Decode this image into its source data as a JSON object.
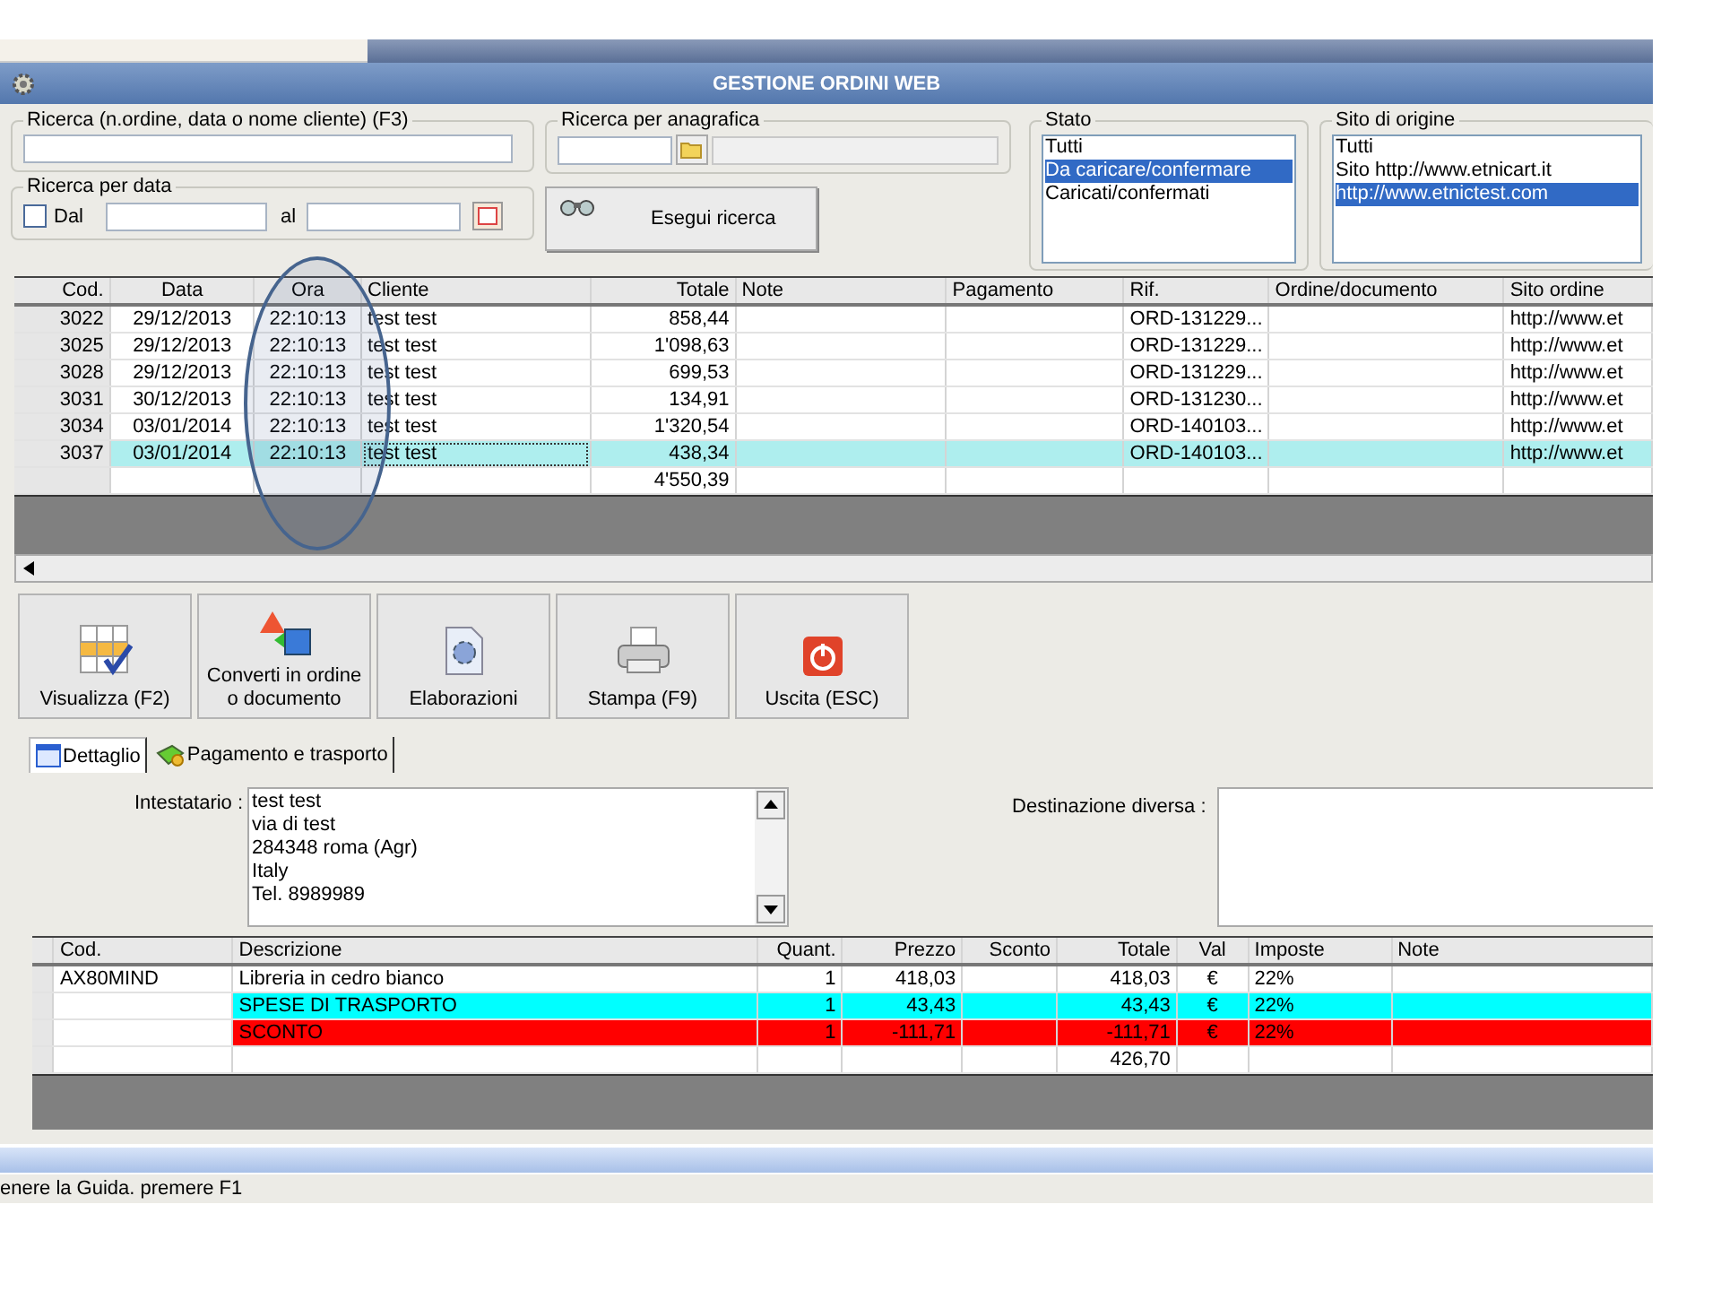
{
  "window": {
    "title": "GESTIONE ORDINI WEB"
  },
  "search": {
    "label": "Ricerca (n.ordine, data o nome cliente) (F3)"
  },
  "anagrafica": {
    "label": "Ricerca per anagrafica"
  },
  "date_search": {
    "label": "Ricerca per data",
    "from_label": "Dal",
    "checked": false,
    "to_label": "al"
  },
  "search_button": "Esegui ricerca",
  "stato": {
    "label": "Stato",
    "options": [
      {
        "label": "Tutti",
        "selected": false
      },
      {
        "label": "Da caricare/confermare",
        "selected": true
      },
      {
        "label": "Caricati/confermati",
        "selected": false
      }
    ]
  },
  "sito": {
    "label": "Sito di origine",
    "options": [
      {
        "label": "Tutti",
        "selected": false
      },
      {
        "label": "Sito http://www.etnicart.it",
        "selected": false
      },
      {
        "label": "http://www.etnictest.com",
        "selected": true
      }
    ]
  },
  "orders": {
    "columns": [
      "Cod.",
      "Data",
      "Ora",
      "Cliente",
      "Totale",
      "Note",
      "Pagamento",
      "Rif.",
      "Ordine/documento",
      "Sito ordine"
    ],
    "rows": [
      {
        "cells": [
          "3022",
          "29/12/2013",
          "22:10:13",
          "test test",
          "858,44",
          "",
          "",
          "ORD-131229...",
          "",
          "http://www.et"
        ],
        "selected": false
      },
      {
        "cells": [
          "3025",
          "29/12/2013",
          "22:10:13",
          "test test",
          "1'098,63",
          "",
          "",
          "ORD-131229...",
          "",
          "http://www.et"
        ],
        "selected": false
      },
      {
        "cells": [
          "3028",
          "29/12/2013",
          "22:10:13",
          "test test",
          "699,53",
          "",
          "",
          "ORD-131229...",
          "",
          "http://www.et"
        ],
        "selected": false
      },
      {
        "cells": [
          "3031",
          "30/12/2013",
          "22:10:13",
          "test test",
          "134,91",
          "",
          "",
          "ORD-131230...",
          "",
          "http://www.et"
        ],
        "selected": false
      },
      {
        "cells": [
          "3034",
          "03/01/2014",
          "22:10:13",
          "test test",
          "1'320,54",
          "",
          "",
          "ORD-140103...",
          "",
          "http://www.et"
        ],
        "selected": false
      },
      {
        "cells": [
          "3037",
          "03/01/2014",
          "22:10:13",
          "test test",
          "438,34",
          "",
          "",
          "ORD-140103...",
          "",
          "http://www.et"
        ],
        "selected": true
      }
    ],
    "total": "4'550,39"
  },
  "actions": [
    {
      "label": "Visualizza (F2)",
      "kind": "grid"
    },
    {
      "label": "Converti in ordine o documento",
      "kind": "convert"
    },
    {
      "label": "Elaborazioni",
      "kind": "gear"
    },
    {
      "label": "Stampa (F9)",
      "kind": "print"
    },
    {
      "label": "Uscita (ESC)",
      "kind": "exit"
    }
  ],
  "tabs": [
    {
      "label": "Dettaglio",
      "selected": true,
      "kind": "window"
    },
    {
      "label": "Pagamento e trasporto",
      "selected": false,
      "kind": "money"
    }
  ],
  "intestatario": {
    "label": "Intestatario :",
    "lines": [
      "test test",
      "via di test",
      "284348 roma (Agr)",
      "Italy",
      "Tel. 8989989"
    ]
  },
  "destinazione": {
    "label": "Destinazione diversa :"
  },
  "items": {
    "columns": [
      "Cod.",
      "Descrizione",
      "Quant.",
      "Prezzo",
      "Sconto",
      "Totale",
      "Val",
      "Imposte",
      "Note"
    ],
    "rows": [
      {
        "cells": [
          "AX80MIND",
          "Libreria in cedro bianco",
          "1",
          "418,03",
          "",
          "418,03",
          "€",
          "22%",
          ""
        ],
        "color": "#ffffff"
      },
      {
        "cells": [
          "",
          "SPESE DI TRASPORTO",
          "1",
          "43,43",
          "",
          "43,43",
          "€",
          "22%",
          ""
        ],
        "color": "#00ffff"
      },
      {
        "cells": [
          "",
          "SCONTO",
          "1",
          "-111,71",
          "",
          "-111,71",
          "€",
          "22%",
          ""
        ],
        "color": "#ff0000"
      }
    ],
    "total": "426,70"
  },
  "status_bar": "enere la Guida. premere F1"
}
